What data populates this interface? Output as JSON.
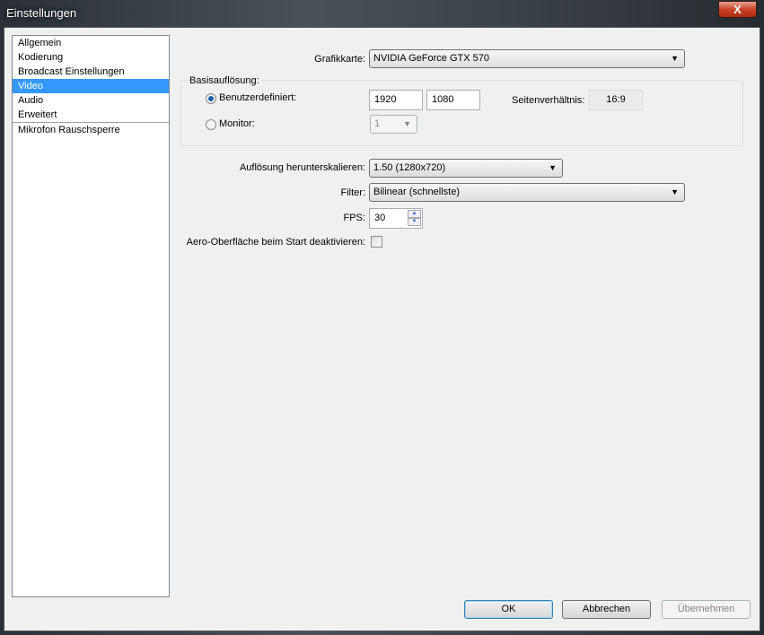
{
  "window": {
    "title": "Einstellungen",
    "close": "X"
  },
  "sidebar": {
    "items": [
      {
        "label": "Allgemein"
      },
      {
        "label": "Kodierung"
      },
      {
        "label": "Broadcast Einstellungen"
      },
      {
        "label": "Video"
      },
      {
        "label": "Audio"
      },
      {
        "label": "Erweitert"
      },
      {
        "label": "Mikrofon Rauschsperre"
      }
    ],
    "selected": "Video"
  },
  "video": {
    "grafikkarte_label": "Grafikkarte:",
    "grafikkarte_value": "NVIDIA GeForce GTX 570",
    "basis_label": "Basisauflösung:",
    "custom_label": "Benutzerdefiniert:",
    "width": "1920",
    "height": "1080",
    "aspect_label": "Seitenverhältnis:",
    "aspect_value": "16:9",
    "monitor_label": "Monitor:",
    "monitor_value": "1",
    "downscale_label": "Auflösung herunterskalieren:",
    "downscale_value": "1.50  (1280x720)",
    "filter_label": "Filter:",
    "filter_value": "Bilinear (schnellste)",
    "fps_label": "FPS:",
    "fps_value": "30",
    "aero_label": "Aero-Oberfläche beim Start deaktivieren:",
    "aero_checked": false
  },
  "buttons": {
    "ok": "OK",
    "cancel": "Abbrechen",
    "apply": "Übernehmen"
  }
}
